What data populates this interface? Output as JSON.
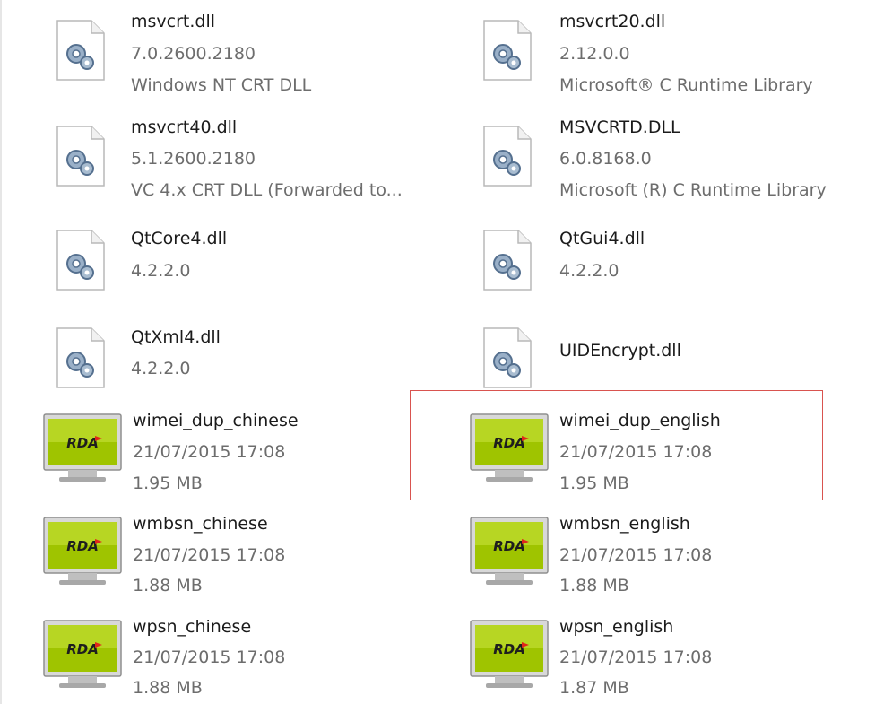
{
  "colors": {
    "selection_border": "#d9534f",
    "name_text": "#1b1b1b",
    "meta_text": "#6d6d6d"
  },
  "files": [
    {
      "name": "msvcrt.dll",
      "line1": "7.0.2600.2180",
      "line2": "Windows NT CRT DLL",
      "icon": "dll-settings-icon"
    },
    {
      "name": "msvcrt20.dll",
      "line1": "2.12.0.0",
      "line2": "Microsoft® C Runtime Library",
      "icon": "dll-settings-icon"
    },
    {
      "name": "msvcrt40.dll",
      "line1": "5.1.2600.2180",
      "line2": "VC 4.x CRT DLL (Forwarded to...",
      "icon": "dll-settings-icon"
    },
    {
      "name": "MSVCRTD.DLL",
      "line1": "6.0.8168.0",
      "line2": "Microsoft (R) C Runtime Library",
      "icon": "dll-settings-icon"
    },
    {
      "name": "QtCore4.dll",
      "line1": "4.2.2.0",
      "line2": "",
      "icon": "dll-settings-icon"
    },
    {
      "name": "QtGui4.dll",
      "line1": "4.2.2.0",
      "line2": "",
      "icon": "dll-settings-icon"
    },
    {
      "name": "QtXml4.dll",
      "line1": "4.2.2.0",
      "line2": "",
      "icon": "dll-settings-icon"
    },
    {
      "name": "UIDEncrypt.dll",
      "line1": "",
      "line2": "",
      "icon": "dll-settings-icon"
    },
    {
      "name": "wimei_dup_chinese",
      "line1": "21/07/2015 17:08",
      "line2": "1.95 MB",
      "icon": "rda-monitor-icon"
    },
    {
      "name": "wimei_dup_english",
      "line1": "21/07/2015 17:08",
      "line2": "1.95 MB",
      "icon": "rda-monitor-icon"
    },
    {
      "name": "wmbsn_chinese",
      "line1": "21/07/2015 17:08",
      "line2": "1.88 MB",
      "icon": "rda-monitor-icon"
    },
    {
      "name": "wmbsn_english",
      "line1": "21/07/2015 17:08",
      "line2": "1.88 MB",
      "icon": "rda-monitor-icon"
    },
    {
      "name": "wpsn_chinese",
      "line1": "21/07/2015 17:08",
      "line2": "1.88 MB",
      "icon": "rda-monitor-icon"
    },
    {
      "name": "wpsn_english",
      "line1": "21/07/2015 17:08",
      "line2": "1.87 MB",
      "icon": "rda-monitor-icon"
    }
  ],
  "rda_label": "RDA"
}
